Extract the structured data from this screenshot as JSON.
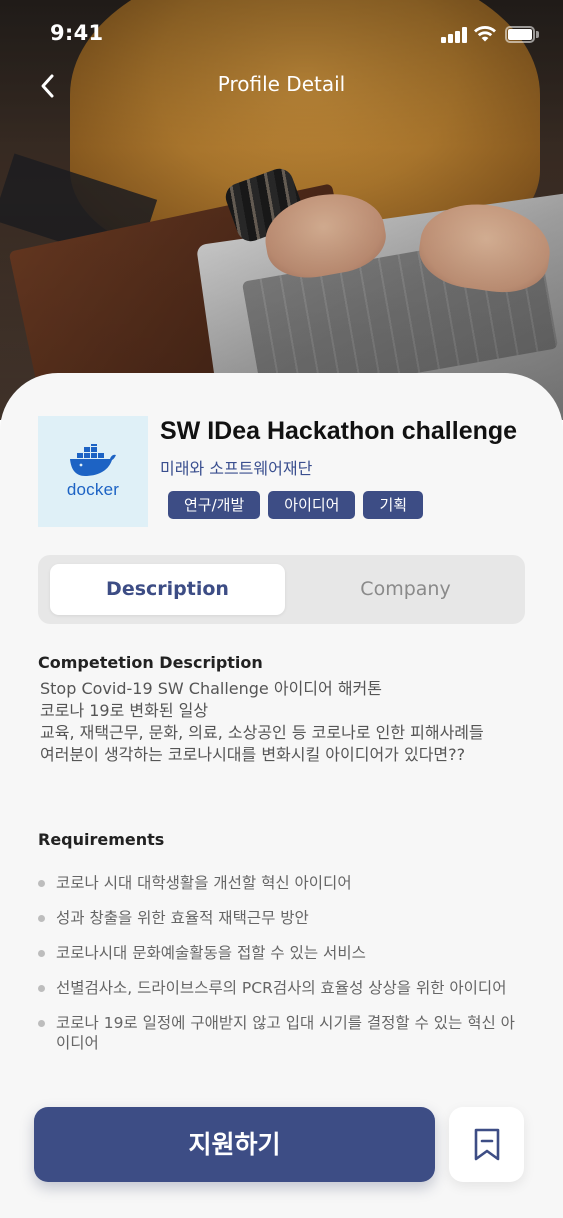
{
  "status_bar": {
    "time": "9:41"
  },
  "nav": {
    "title": "Profile Detail",
    "back_icon": "chevron-left-icon"
  },
  "job": {
    "logo_text": "docker",
    "title": "SW IDea Hackathon challenge",
    "company": "미래와 소프트웨어재단",
    "tags": [
      "연구/개발",
      "아이디어",
      "기획"
    ]
  },
  "tabs": {
    "description": "Description",
    "company": "Company",
    "active": "Description"
  },
  "description": {
    "heading": "Competetion Description",
    "lines": [
      "Stop Covid-19 SW Challenge 아이디어 해커톤",
      "코로나 19로 변화된 일상",
      "교육, 재택근무, 문화, 의료, 소상공인 등 코로나로 인한 피해사례들",
      "여러분이 생각하는 코로나시대를 변화시킬 아이디어가 있다면??"
    ]
  },
  "requirements": {
    "heading": "Requirements",
    "items": [
      "코로나 시대 대학생활을 개선할 혁신 아이디어",
      "성과 창출을 위한 효율적 재택근무 방안",
      "코로나시대 문화예술활동을 접할 수 있는 서비스",
      "선별검사소, 드라이브스루의 PCR검사의 효율성 상상을 위한 아이디어",
      "코로나 19로 일정에 구애받지 않고 입대 시기를 결정할 수 있는 혁신 아이디어"
    ]
  },
  "actions": {
    "apply_label": "지원하기",
    "bookmark_icon": "bookmark-icon"
  },
  "colors": {
    "primary": "#3d4d85",
    "sheet_bg": "#f7f7f7",
    "logo_bg": "#dff0f7",
    "docker_blue": "#1d63c4"
  }
}
